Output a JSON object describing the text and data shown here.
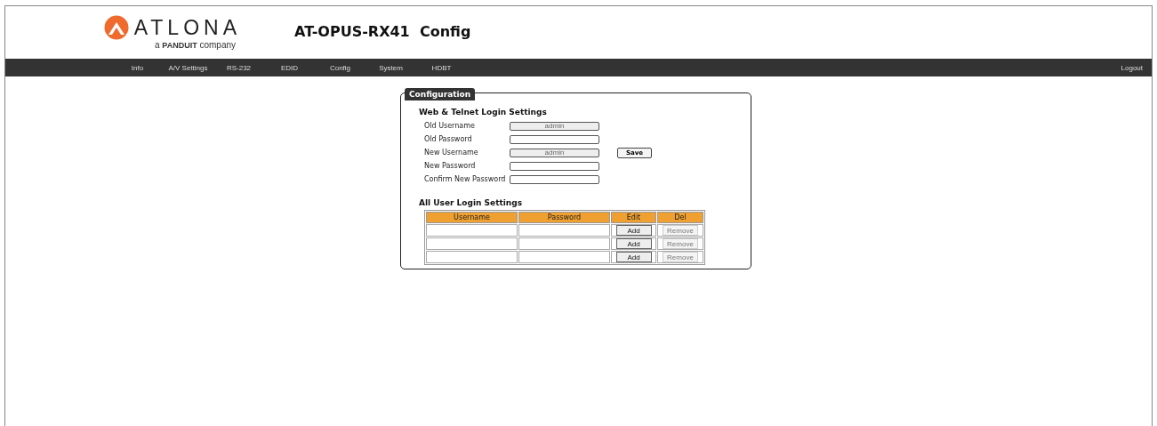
{
  "header": {
    "logo_text": "ATLONA",
    "logo_tagline_prefix": "a",
    "logo_tagline_brand": "PANDUIT",
    "logo_tagline_suffix": "company",
    "title": "AT-OPUS-RX41  Config"
  },
  "nav": {
    "items": [
      {
        "label": "Info"
      },
      {
        "label": "A/V Settings"
      },
      {
        "label": "RS-232"
      },
      {
        "label": "EDID"
      },
      {
        "label": "Config"
      },
      {
        "label": "System"
      },
      {
        "label": "HDBT"
      }
    ],
    "logout": "Logout"
  },
  "panel": {
    "legend": "Configuration",
    "login_section": {
      "title": "Web & Telnet Login Settings",
      "fields": [
        {
          "label": "Old Username",
          "value": "admin",
          "disabled": true
        },
        {
          "label": "Old Password",
          "disabled": false
        },
        {
          "label": "New Username",
          "value": "admin",
          "disabled": true
        },
        {
          "label": "New Password",
          "disabled": false
        },
        {
          "label": "Confirm New Password",
          "disabled": false
        }
      ],
      "save_button": "Save"
    },
    "users_section": {
      "title": "All User Login Settings",
      "columns": [
        "Username",
        "Password",
        "Edit",
        "Del"
      ],
      "rows": [
        {
          "edit": "Add",
          "del": "Remove",
          "del_disabled": true
        },
        {
          "edit": "Add",
          "del": "Remove",
          "del_disabled": true
        },
        {
          "edit": "Add",
          "del": "Remove",
          "del_disabled": true
        }
      ]
    }
  }
}
